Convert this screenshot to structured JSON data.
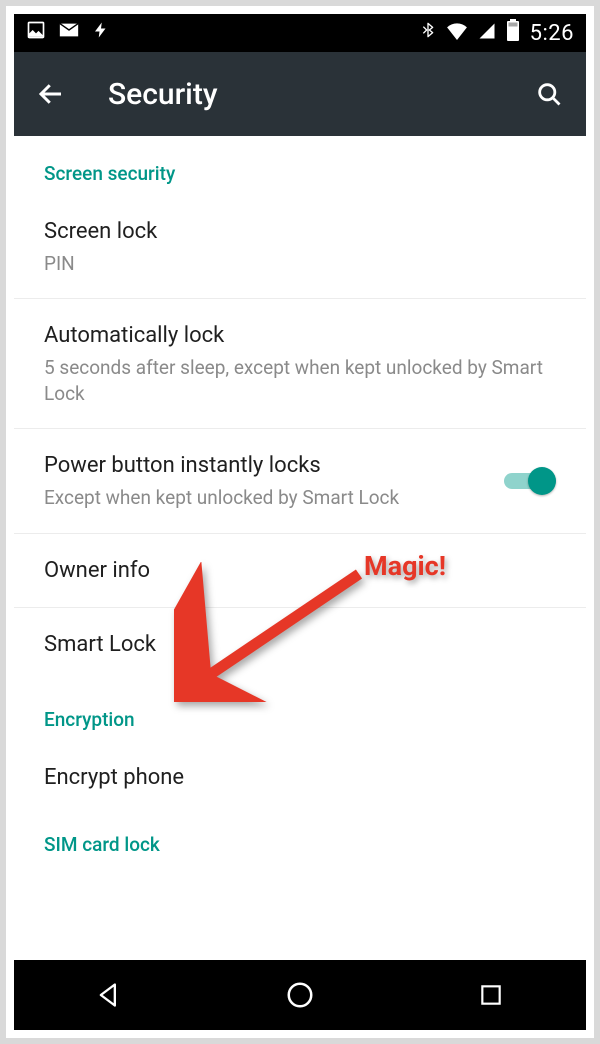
{
  "statusbar": {
    "clock": "5:26",
    "icons_left": [
      "picture-icon",
      "mail-icon",
      "bolt-icon"
    ],
    "icons_right": [
      "bluetooth-icon",
      "wifi-icon",
      "cell-signal-icon",
      "battery-icon"
    ]
  },
  "toolbar": {
    "title": "Security"
  },
  "sections": {
    "screen_security": {
      "header": "Screen security",
      "screen_lock": {
        "title": "Screen lock",
        "subtitle": "PIN"
      },
      "auto_lock": {
        "title": "Automatically lock",
        "subtitle": "5 seconds after sleep, except when kept unlocked by Smart Lock"
      },
      "power_lock": {
        "title": "Power button instantly locks",
        "subtitle": "Except when kept unlocked by Smart Lock",
        "toggle": true
      },
      "owner_info": {
        "title": "Owner info"
      },
      "smart_lock": {
        "title": "Smart Lock"
      }
    },
    "encryption": {
      "header": "Encryption",
      "encrypt_phone": {
        "title": "Encrypt phone"
      }
    },
    "sim_card_lock": {
      "header": "SIM card lock"
    }
  },
  "annotation": {
    "label": "Magic!"
  },
  "colors": {
    "accent": "#009688"
  }
}
